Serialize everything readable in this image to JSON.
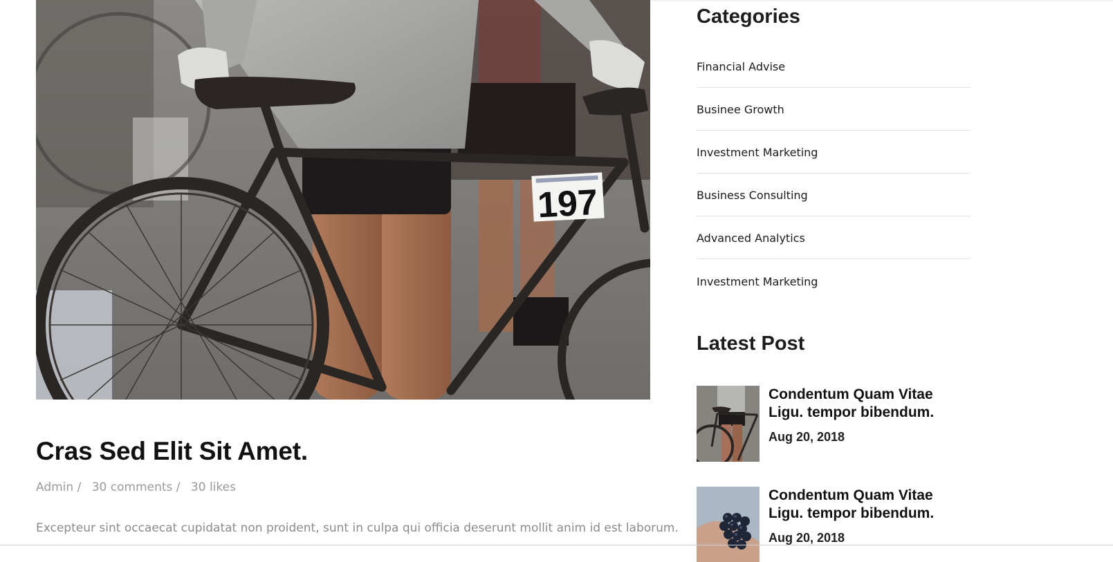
{
  "post": {
    "image_alt": "Person standing with vintage racing bicycle",
    "bib_number": "197",
    "title": "Cras Sed Elit Sit Amet.",
    "meta": {
      "author": "Admin /",
      "comments": "30 comments /",
      "likes": "30 likes"
    },
    "excerpt": "Excepteur sint occaecat cupidatat non proident, sunt in culpa qui officia deserunt mollit anim id est laborum."
  },
  "sidebar": {
    "categories_title": "Categories",
    "categories": [
      "Financial Advise",
      "Businee Growth",
      "Investment Marketing",
      "Business Consulting",
      "Advanced Analytics",
      "Investment Marketing"
    ],
    "latest_title": "Latest Post",
    "latest_posts": [
      {
        "title": "Condentum Quam Vitae Ligu. tempor bibendum.",
        "date": "Aug 20, 2018",
        "thumb": "bicycle-thumbnail"
      },
      {
        "title": "Condentum Quam Vitae Ligu. tempor bibendum.",
        "date": "Aug 20, 2018",
        "thumb": "grapes-thumbnail"
      }
    ]
  },
  "colors": {
    "heading": "#111111",
    "meta": "#9a9a9a",
    "divider": "#e1e1e1",
    "body_text": "#8a8a8a"
  }
}
